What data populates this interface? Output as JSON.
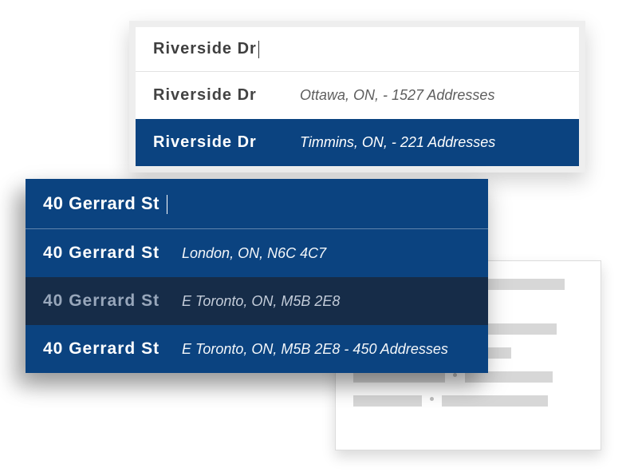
{
  "upper": {
    "query": "Riverside Dr",
    "suggestions": [
      {
        "name": "Riverside Dr",
        "meta": "Ottawa, ON, - 1527 Addresses"
      },
      {
        "name": "Riverside Dr",
        "meta": "Timmins, ON, - 221 Addresses"
      }
    ]
  },
  "lower": {
    "query": "40 Gerrard St",
    "suggestions": [
      {
        "name": "40 Gerrard St",
        "meta": "London, ON, N6C 4C7"
      },
      {
        "name": "40 Gerrard St",
        "meta": "E Toronto, ON, M5B 2E8"
      },
      {
        "name": "40 Gerrard St",
        "meta": "E Toronto, ON, M5B 2E8 - 450 Addresses"
      }
    ]
  }
}
